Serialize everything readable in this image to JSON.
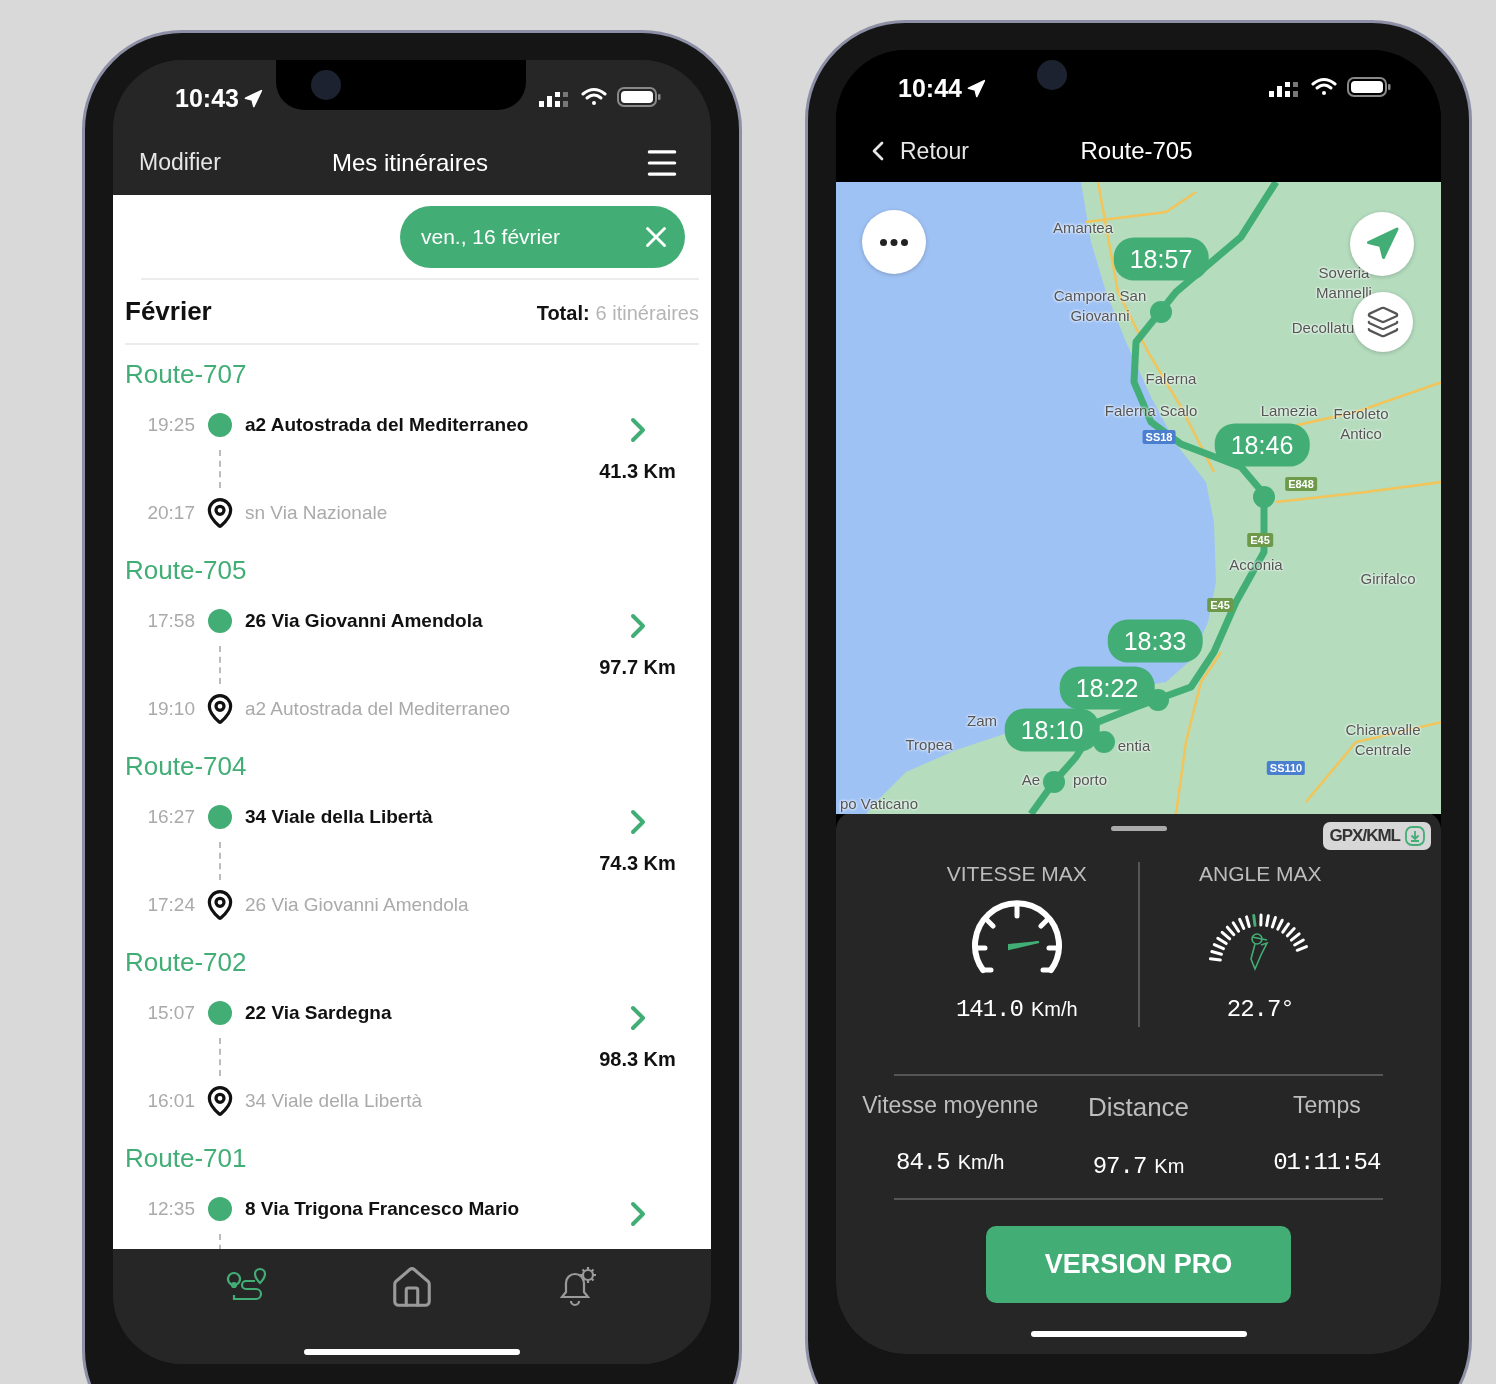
{
  "list_screen": {
    "status_bar": {
      "time": "10:43"
    },
    "nav": {
      "left": "Modifier",
      "title": "Mes itinéraires"
    },
    "filter_chip": {
      "label": "ven., 16 février"
    },
    "month": {
      "title": "Février",
      "total_label": "Total:",
      "total_value": "6 itinéraires"
    },
    "routes": [
      {
        "name": "Route-707",
        "start": {
          "time": "19:25",
          "address": "a2 Autostrada del Mediterraneo"
        },
        "end": {
          "time": "20:17",
          "address": "sn Via Nazionale"
        },
        "distance": "41.3 Km"
      },
      {
        "name": "Route-705",
        "start": {
          "time": "17:58",
          "address": "26 Via Giovanni Amendola"
        },
        "end": {
          "time": "19:10",
          "address": "a2 Autostrada del Mediterraneo"
        },
        "distance": "97.7 Km"
      },
      {
        "name": "Route-704",
        "start": {
          "time": "16:27",
          "address": "34 Viale della Libertà"
        },
        "end": {
          "time": "17:24",
          "address": "26 Via Giovanni Amendola"
        },
        "distance": "74.3 Km"
      },
      {
        "name": "Route-702",
        "start": {
          "time": "15:07",
          "address": "22 Via Sardegna"
        },
        "end": {
          "time": "16:01",
          "address": "34 Viale della Libertà"
        },
        "distance": "98.3 Km"
      },
      {
        "name": "Route-701",
        "start": {
          "time": "12:35",
          "address": "8 Via Trigona Francesco Mario"
        }
      }
    ],
    "tab_bar": [
      {
        "kind": "routes",
        "selected": true
      },
      {
        "kind": "home",
        "selected": false
      },
      {
        "kind": "alerts",
        "selected": false
      }
    ]
  },
  "map_screen": {
    "status_bar": {
      "time": "10:44"
    },
    "nav": {
      "back": "Retour",
      "title": "Route-705"
    },
    "map": {
      "place_labels": [
        "Amantea",
        "Campora San Giovanni",
        "Soveria Mannelli",
        "Decollatu",
        "Falerna",
        "Falerna Scalo",
        "Lamezia",
        "Feroleto Antico",
        "Acconia",
        "Girifalco",
        "Zam",
        "Tropea",
        "Chiaravalle Centrale",
        "po Vaticano",
        "entia",
        "Ae",
        "porto"
      ],
      "road_badges": [
        {
          "label": "SS18",
          "kind": "ss"
        },
        {
          "label": "E848",
          "kind": "e"
        },
        {
          "label": "E45",
          "kind": "e"
        },
        {
          "label": "E45",
          "kind": "e"
        },
        {
          "label": "SS110",
          "kind": "ss"
        }
      ],
      "time_markers": [
        "18:57",
        "18:46",
        "18:33",
        "18:22",
        "18:10"
      ]
    },
    "sheet": {
      "export_button": "GPX/KML",
      "max_stats": [
        {
          "kind": "speed",
          "label": "VITESSE MAX",
          "value": "141.0",
          "unit": "Km/h"
        },
        {
          "kind": "angle",
          "label": "ANGLE MAX",
          "value": "22.7°"
        }
      ],
      "summary": [
        {
          "label": "Vitesse moyenne",
          "value": "84.5",
          "unit": "Km/h"
        },
        {
          "label": "Distance",
          "value": "97.7",
          "unit": "Km"
        },
        {
          "label": "Temps",
          "value": "01:11:54"
        }
      ],
      "cta": "VERSION PRO"
    }
  }
}
